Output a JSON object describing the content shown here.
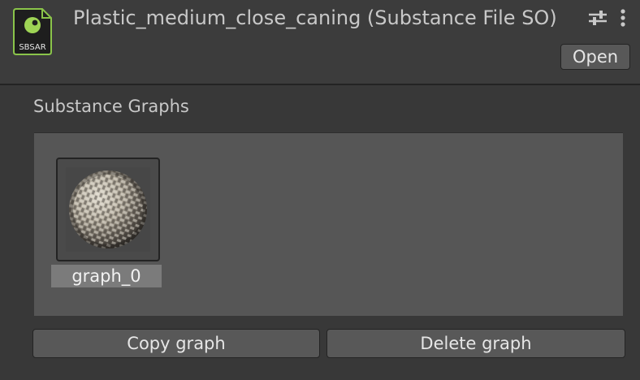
{
  "header": {
    "file_icon": {
      "name": "sbsar-file-icon",
      "label": "SBSAR",
      "accent": "#8ac44a"
    },
    "title": "Plastic_medium_close_caning (Substance File SO)",
    "settings_icon": "sliders-icon",
    "menu_icon": "kebab-menu-icon",
    "open_label": "Open"
  },
  "section": {
    "title": "Substance Graphs"
  },
  "graphs": [
    {
      "label": "graph_0",
      "thumbnail": "woven-caning-sphere"
    }
  ],
  "actions": {
    "copy_label": "Copy graph",
    "delete_label": "Delete graph"
  },
  "colors": {
    "background": "#383838",
    "panel": "#565656",
    "selection": "#7b7b7b",
    "button": "#585858"
  }
}
